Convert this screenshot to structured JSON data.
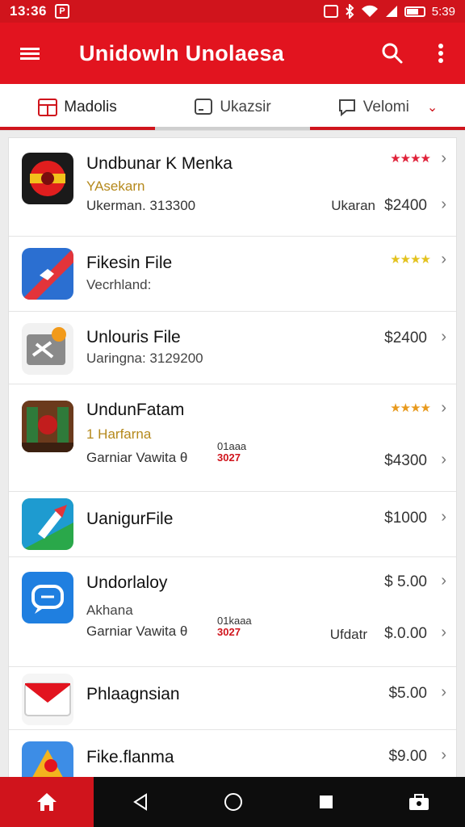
{
  "status_bar": {
    "time": "13:36",
    "notif_glyph": "P",
    "clock_right": "5:39"
  },
  "app_bar": {
    "title": "Unidowln Unolaesa"
  },
  "tabs": [
    {
      "label": "Madolis"
    },
    {
      "label": "Ukazsir"
    },
    {
      "label": "Velomi"
    }
  ],
  "items": [
    {
      "name": "Undbunar K Menka",
      "sub": "YAsekarn",
      "meta": "Ukerman. 313300",
      "side_label": "Ukaran",
      "price": "$2400",
      "stars": "★★★★",
      "star_color": "#e0223a"
    },
    {
      "name": "Fikesin File",
      "sub": "Vecrhland:",
      "stars": "★★★★",
      "star_color": "#e3c21e"
    },
    {
      "name": "Unlouris File",
      "sub": "Uaringna: 3129200",
      "price": "$2400"
    },
    {
      "name": "UndunFatam",
      "sub": "1 Harfarna",
      "meta": "Garniar Vawita θ",
      "badge_top": "01aaa",
      "badge_bottom": "3027",
      "price": "$4300",
      "stars": "★★★★",
      "star_color": "#e89a1e"
    },
    {
      "name": "UanigurFile",
      "price": "$1000"
    },
    {
      "name": "Undorlaloy",
      "sub": "Akhana",
      "meta": "Garniar Vawita θ",
      "badge_top": "01kaaa",
      "badge_bottom": "3027",
      "price_top": "$ 5.00",
      "side_label": "Ufdatr",
      "price": "$.0.00"
    },
    {
      "name": "Phlaagnsian",
      "price": "$5.00"
    },
    {
      "name": "Fike.flanma",
      "price": "$9.00"
    }
  ],
  "colors": {
    "brand_red": "#e2141f",
    "nav_bg": "#0d0d0d"
  },
  "icons": [
    "menu-icon",
    "search-icon",
    "more-vert-icon",
    "home-icon",
    "back-icon",
    "circle-home-icon",
    "square-recents-icon",
    "briefcase-icon"
  ]
}
